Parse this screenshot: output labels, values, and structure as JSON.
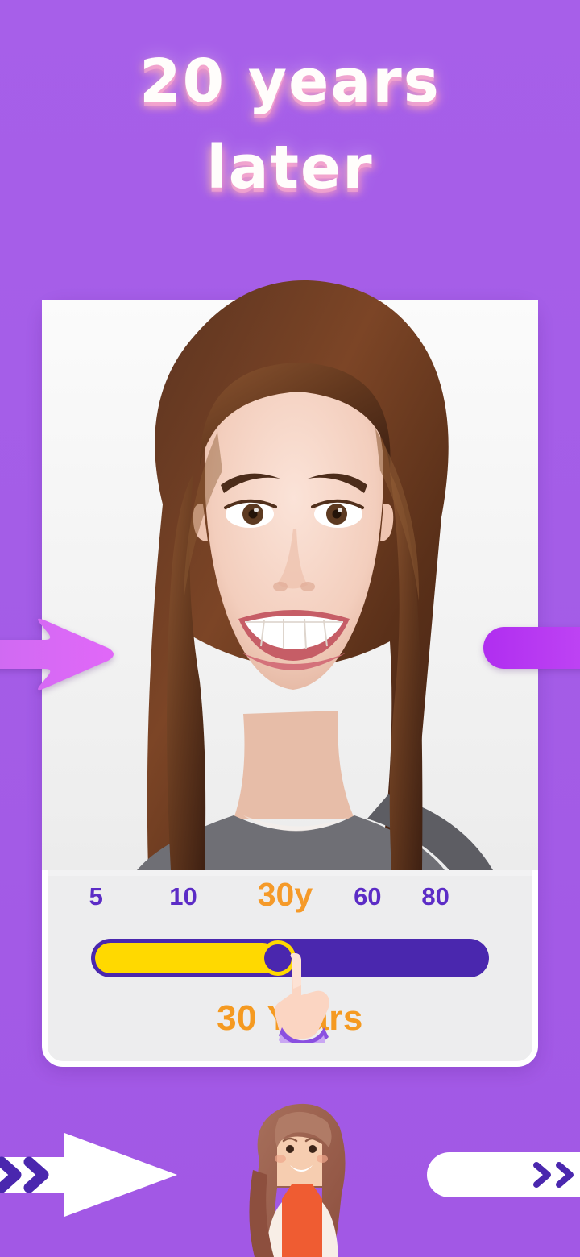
{
  "app": {
    "background_color": "#a45de7",
    "card_background": "#ededee"
  },
  "header": {
    "title_line1": "20 years",
    "title_line2": "later",
    "title_color": "#fffdfb"
  },
  "photo": {
    "alt": "portrait of smiling young woman with long brown hair",
    "background_color": "#f2f2f3"
  },
  "slider": {
    "accent_color": "#f59a29",
    "track_color": "#4a27ae",
    "fill_color": "#ffd900",
    "tick_color": "#5c2cc6",
    "current_value": 30,
    "min": 5,
    "max": 80,
    "fill_percent": 48,
    "ticks": [
      {
        "label": "5",
        "value": 5,
        "position_percent": 6,
        "current": false
      },
      {
        "label": "10",
        "value": 10,
        "position_percent": 26,
        "current": false
      },
      {
        "label": "30y",
        "value": 30,
        "position_percent": 50,
        "current": true
      },
      {
        "label": "60",
        "value": 60,
        "position_percent": 70,
        "current": false
      },
      {
        "label": "80",
        "value": 80,
        "position_percent": 88,
        "current": false
      }
    ],
    "value_label": "30 Years",
    "pointer_icon": "pointing-hand-icon"
  },
  "footer": {
    "left_arrow_icon": "arrow-right-icon",
    "left_arrow_chevrons": "››",
    "mascot_icon": "cartoon-girl-icon",
    "right_pill_chevrons": "››",
    "chevron_color": "#4a27ae"
  },
  "decor": {
    "left_side_arrow_icon": "arrow-right-decor-icon",
    "right_side_bar_icon": "rounded-bar-decor-icon",
    "decor_color_light": "#d964f5",
    "decor_color_deep": "#b02ef0"
  }
}
